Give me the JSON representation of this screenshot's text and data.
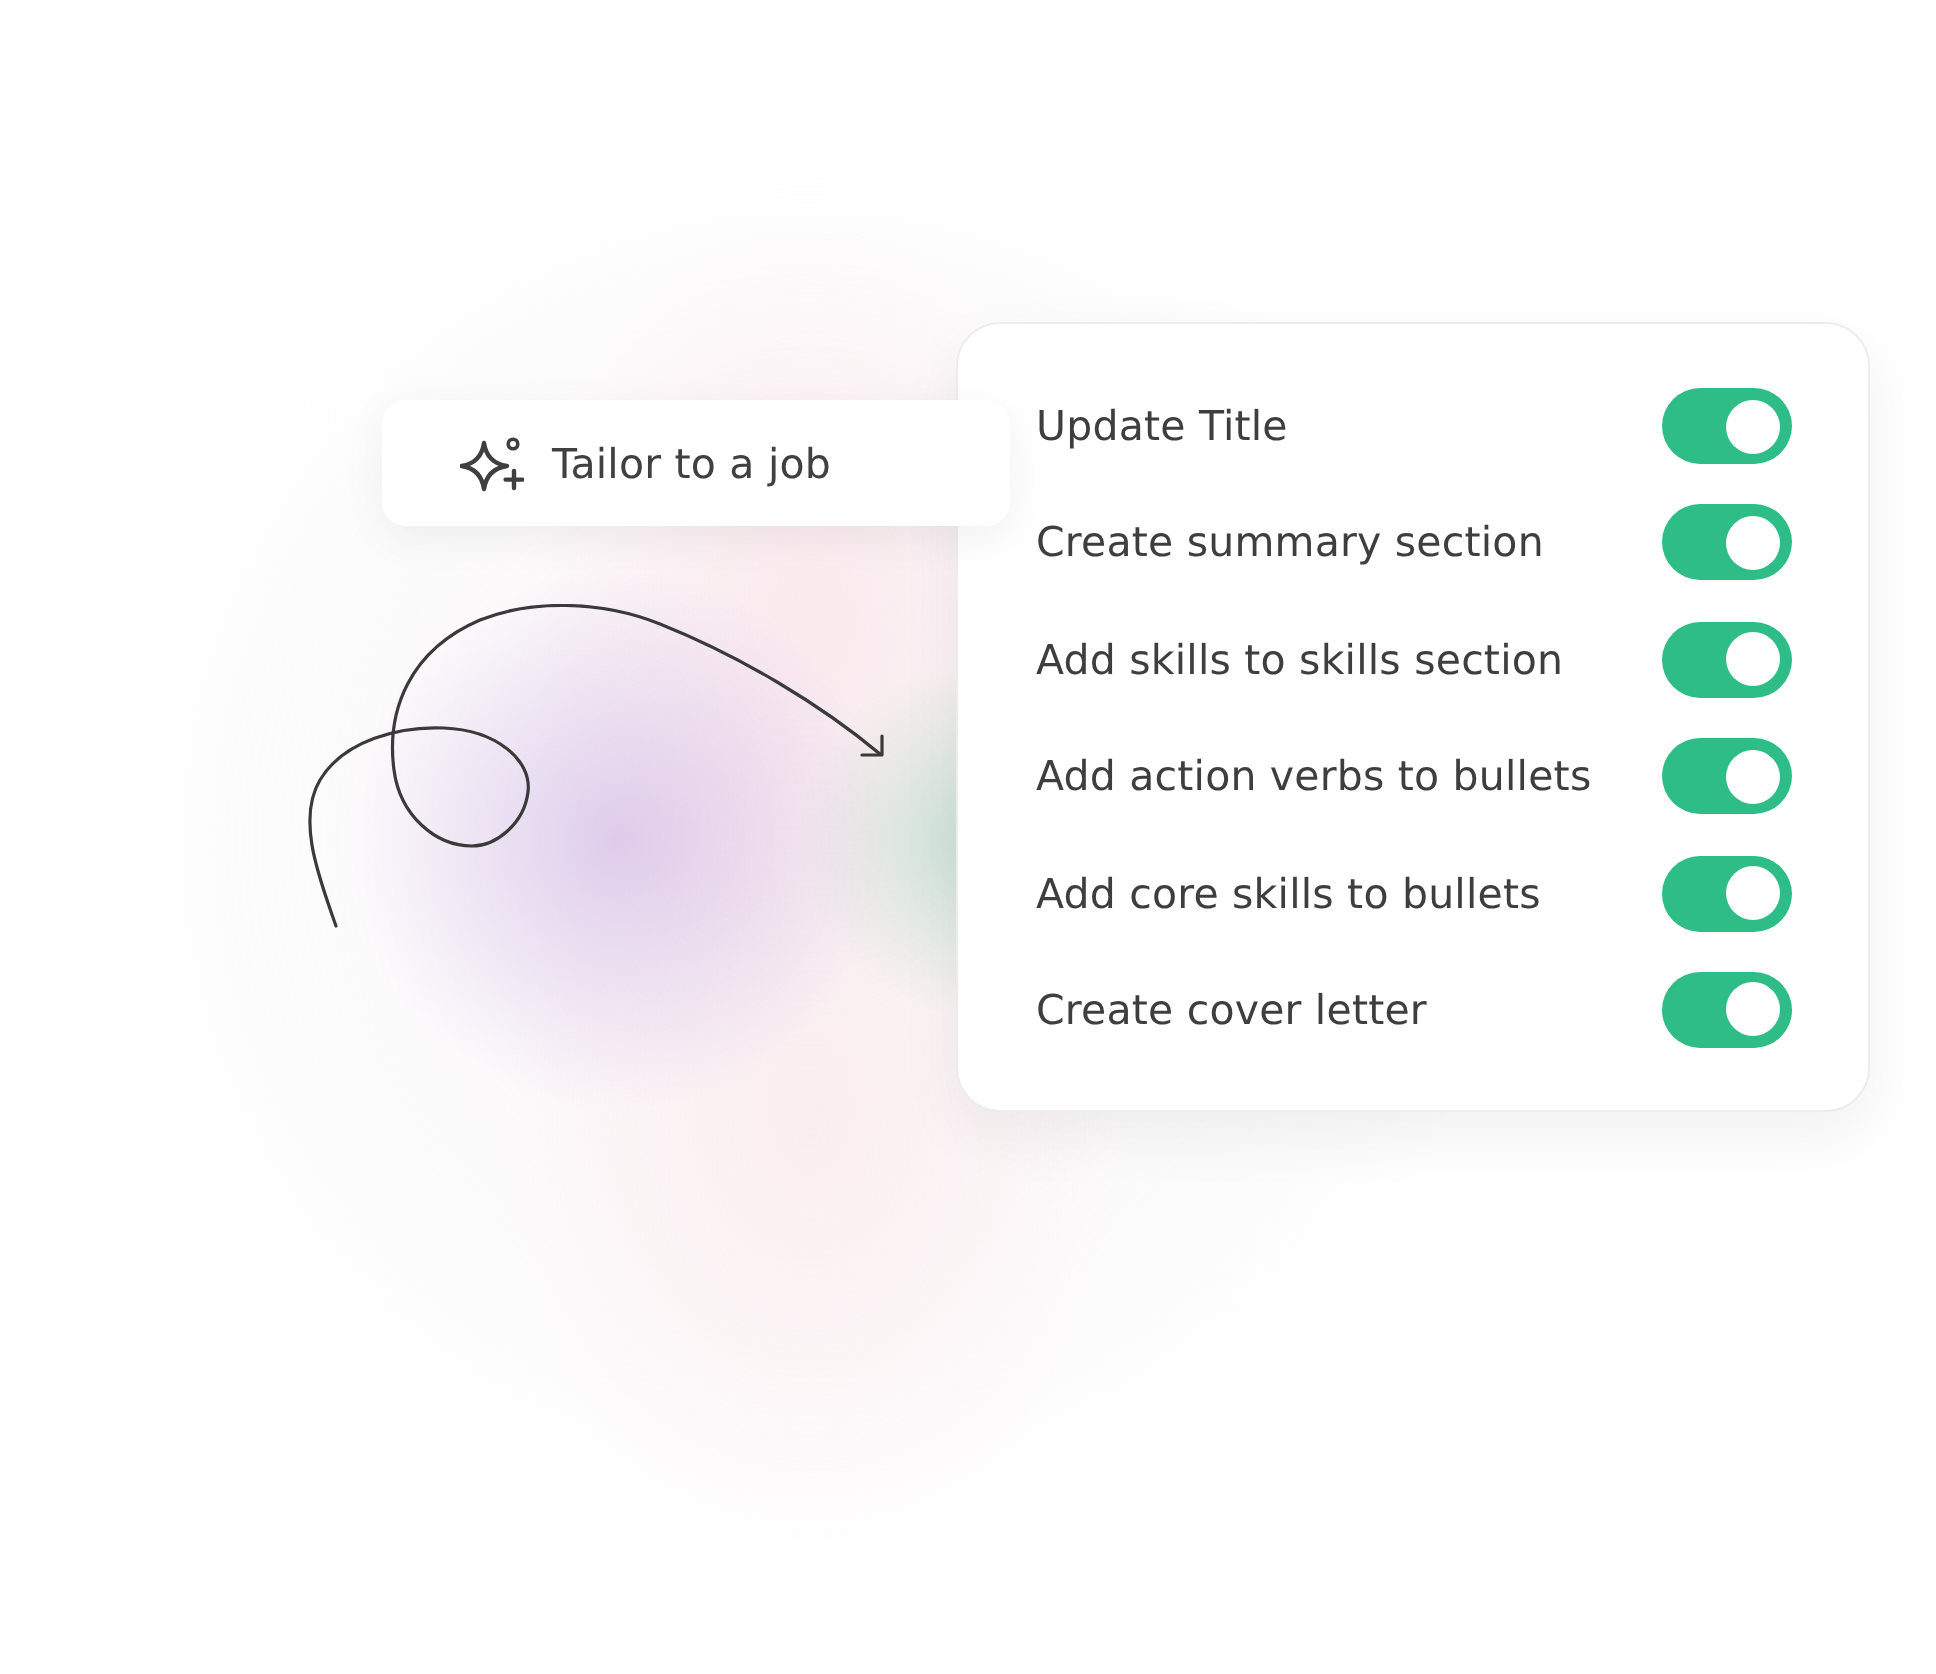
{
  "tailor_button": {
    "label": "Tailor to a job"
  },
  "options": [
    {
      "label": "Update Title",
      "on": true
    },
    {
      "label": "Create summary section",
      "on": true
    },
    {
      "label": "Add skills to skills section",
      "on": true
    },
    {
      "label": "Add action verbs to bullets",
      "on": true
    },
    {
      "label": "Add core skills to bullets",
      "on": true
    },
    {
      "label": "Create cover letter",
      "on": true
    }
  ]
}
